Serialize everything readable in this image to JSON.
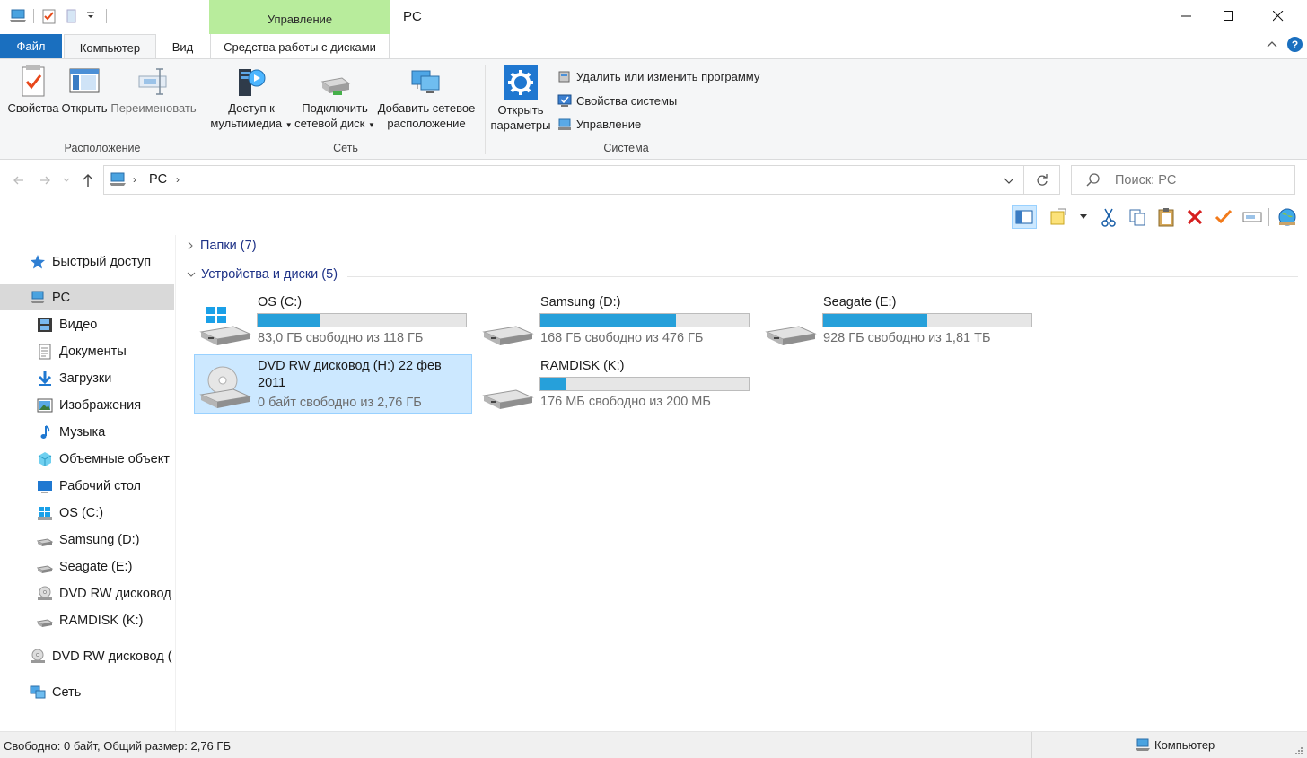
{
  "window": {
    "title": "PC",
    "context_tab": "Управление"
  },
  "tabs": {
    "file": "Файл",
    "computer": "Компьютер",
    "view": "Вид",
    "disk_tools": "Средства работы с дисками"
  },
  "ribbon": {
    "location": {
      "label": "Расположение",
      "properties": "Свойства",
      "open": "Открыть",
      "rename": "Переименовать"
    },
    "network": {
      "label": "Сеть",
      "media_line1": "Доступ к",
      "media_line2": "мультимедиа",
      "map_line1": "Подключить",
      "map_line2": "сетевой диск",
      "add_line1": "Добавить сетевое",
      "add_line2": "расположение"
    },
    "system": {
      "label": "Система",
      "settings_line1": "Открыть",
      "settings_line2": "параметры",
      "uninstall": "Удалить или изменить программу",
      "sysprops": "Свойства системы",
      "manage": "Управление"
    }
  },
  "address": {
    "crumb": "PC",
    "search_placeholder": "Поиск: PC"
  },
  "nav": {
    "quick_access": "Быстрый доступ",
    "pc": "PC",
    "items": [
      "Видео",
      "Документы",
      "Загрузки",
      "Изображения",
      "Музыка",
      "Объемные объект",
      "Рабочий стол",
      "OS (C:)",
      "Samsung (D:)",
      "Seagate (E:)",
      "DVD RW дисковод",
      "RAMDISK (K:)"
    ],
    "dvd": "DVD RW дисковод (",
    "network": "Сеть"
  },
  "content": {
    "folders_group": "Папки (7)",
    "devices_group": "Устройства и диски (5)",
    "drives": [
      {
        "name": "OS (C:)",
        "free": "83,0 ГБ свободно из 118 ГБ",
        "used_fraction": 0.3
      },
      {
        "name": "Samsung (D:)",
        "free": "168 ГБ свободно из 476 ГБ",
        "used_fraction": 0.65
      },
      {
        "name": "Seagate (E:)",
        "free": "928 ГБ свободно из 1,81 ТБ",
        "used_fraction": 0.5
      },
      {
        "name": "DVD RW дисковод (H:) 22 фев 2011",
        "free": "0 байт свободно из 2,76 ГБ"
      },
      {
        "name": "RAMDISK (K:)",
        "free": "176 МБ свободно из 200 МБ",
        "used_fraction": 0.12
      }
    ]
  },
  "status": {
    "left": "Свободно: 0 байт, Общий размер: 2,76 ГБ",
    "right": "Компьютер"
  },
  "colors": {
    "accent": "#1a6fbf",
    "manage_tab": "#b8ec9c",
    "bar_fill": "#26a0da",
    "selection": "#cce8ff"
  }
}
